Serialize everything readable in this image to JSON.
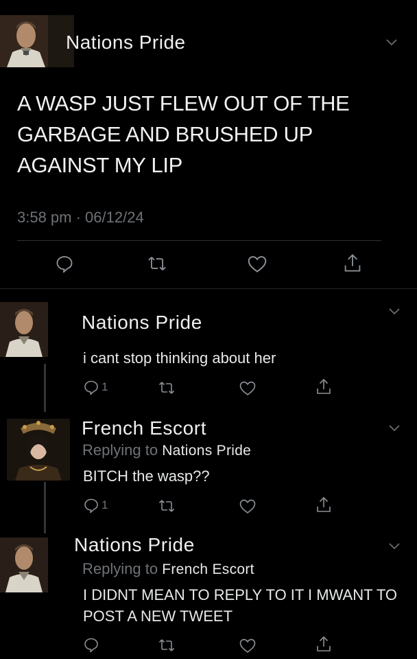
{
  "main_tweet": {
    "author": "Nations Pride",
    "text": "A WASP JUST FLEW OUT OF THE GARBAGE AND BRUSHED UP AGAINST MY LIP",
    "meta": "3:58 pm · 06/12/24",
    "actions": [
      "reply-icon",
      "retweet-icon",
      "like-icon",
      "share-icon"
    ]
  },
  "replies": [
    {
      "author": "Nations Pride",
      "text": "i cant stop thinking about her",
      "reply_count": "1",
      "actions": [
        "reply-icon",
        "retweet-icon",
        "like-icon",
        "share-icon"
      ]
    },
    {
      "author": "French Escort",
      "replying_label": "Replying to",
      "replying_to": "Nations Pride",
      "text": "BITCH the wasp??",
      "reply_count": "1",
      "actions": [
        "reply-icon",
        "retweet-icon",
        "like-icon",
        "share-icon"
      ]
    },
    {
      "author": "Nations Pride",
      "replying_label": "Replying to",
      "replying_to": "French Escort",
      "text": "I DIDNT MEAN TO REPLY TO IT I MWANT TO POST A NEW TWEET",
      "actions": [
        "reply-icon",
        "retweet-icon",
        "like-icon",
        "share-icon"
      ]
    }
  ],
  "colors": {
    "background": "#000000",
    "text": "#e7e9ea",
    "muted": "#6e7378",
    "divider": "#2f3336"
  }
}
